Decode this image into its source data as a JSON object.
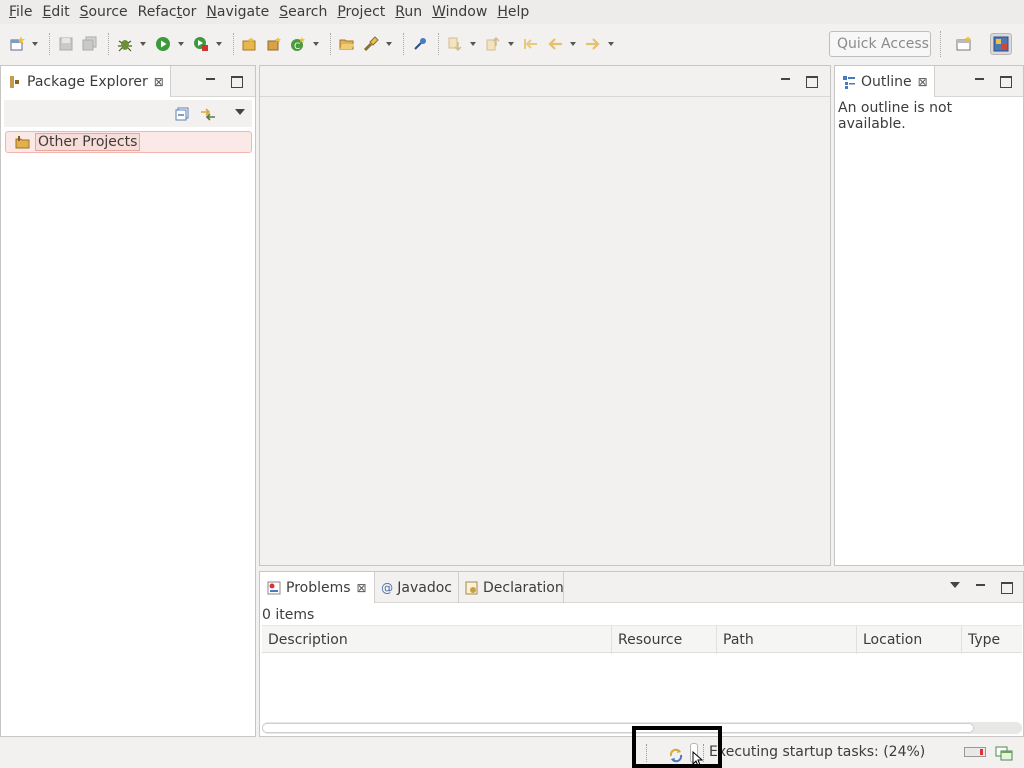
{
  "menubar": {
    "items": [
      {
        "mnemonic": "F",
        "rest": "ile"
      },
      {
        "mnemonic": "E",
        "rest": "dit"
      },
      {
        "mnemonic": "S",
        "rest": "ource"
      },
      {
        "mnemonic": "",
        "pre": "Refac",
        "mn2": "t",
        "rest2": "or"
      },
      {
        "mnemonic": "N",
        "rest": "avigate"
      },
      {
        "mnemonic": "S",
        "rest": "earch"
      },
      {
        "mnemonic": "P",
        "rest": "roject"
      },
      {
        "mnemonic": "R",
        "rest": "un"
      },
      {
        "mnemonic": "W",
        "rest": "indow"
      },
      {
        "mnemonic": "H",
        "rest": "elp"
      }
    ]
  },
  "toolbar": {
    "quick_access_placeholder": "Quick Access"
  },
  "package_explorer": {
    "title": "Package Explorer",
    "tree": [
      {
        "label": "Other Projects",
        "icon": "working-set-icon"
      }
    ]
  },
  "outline": {
    "title": "Outline",
    "message": "An outline is not available."
  },
  "bottom_panel": {
    "tabs": [
      {
        "label": "Problems",
        "icon": "problems-icon",
        "active": true
      },
      {
        "label": "Javadoc",
        "icon": "javadoc-icon",
        "active": false
      },
      {
        "label": "Declaration",
        "icon": "declaration-icon",
        "active": false
      }
    ],
    "items_count": "0 items",
    "columns": [
      "Description",
      "Resource",
      "Path",
      "Location",
      "Type"
    ]
  },
  "statusbar": {
    "progress_text": "Executing startup tasks: (24%)",
    "progress_percent": 24
  },
  "colors": {
    "selection_bg": "#fbe9e7",
    "selection_border": "#f2b6ae",
    "progress_highlight": "#000000"
  }
}
